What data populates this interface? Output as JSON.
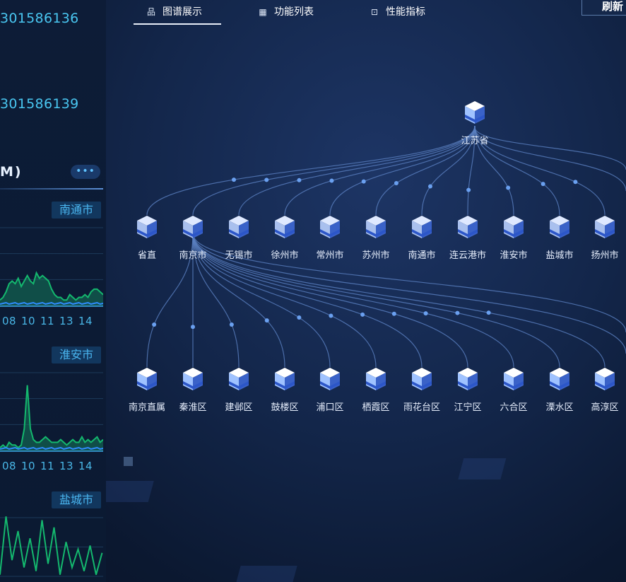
{
  "left_panel": {
    "id_1": "301586136",
    "id_2": "301586139",
    "section_title": "M)",
    "more_button": "•••",
    "charts": [
      {
        "city": "南通市",
        "color": "#14b86e",
        "values": [
          2,
          3,
          5,
          8,
          9,
          8,
          10,
          7,
          9,
          11,
          9,
          8,
          12,
          10,
          11,
          10,
          9,
          6,
          4,
          3,
          3,
          2,
          2,
          4,
          3,
          2,
          3,
          3,
          4,
          3,
          5,
          6,
          6,
          5,
          4
        ]
      },
      {
        "city": "淮安市",
        "color": "#14b86e",
        "values": [
          1,
          2,
          1,
          3,
          2,
          2,
          1,
          2,
          8,
          24,
          8,
          4,
          3,
          3,
          4,
          5,
          4,
          3,
          3,
          3,
          4,
          3,
          2,
          3,
          4,
          3,
          3,
          5,
          3,
          4,
          3,
          4,
          5,
          3,
          4
        ]
      },
      {
        "city": "盐城市",
        "color": "#14b86e",
        "values": []
      }
    ],
    "axis_labels": [
      "08",
      "10",
      "11",
      "13",
      "14"
    ]
  },
  "tabs": [
    {
      "label": "图谱展示",
      "icon": "sitemap-icon",
      "active": true
    },
    {
      "label": "功能列表",
      "icon": "grid-icon",
      "active": false
    },
    {
      "label": "性能指标",
      "icon": "terminal-icon",
      "active": false
    }
  ],
  "refresh_button": "刷新",
  "graph": {
    "root": "江苏省",
    "level1": [
      "省直",
      "南京市",
      "无锡市",
      "徐州市",
      "常州市",
      "苏州市",
      "南通市",
      "连云港市",
      "淮安市",
      "盐城市",
      "扬州市"
    ],
    "level2": [
      "南京直属",
      "秦淮区",
      "建邺区",
      "鼓楼区",
      "浦口区",
      "栖霞区",
      "雨花台区",
      "江宁区",
      "六合区",
      "溧水区",
      "高淳区"
    ]
  },
  "colors": {
    "line": "#5a7fc0",
    "dot": "#6aa0f0",
    "accent": "#49c6f0",
    "node_top": "#dfe9ff",
    "node_side": "#3a62c8"
  }
}
